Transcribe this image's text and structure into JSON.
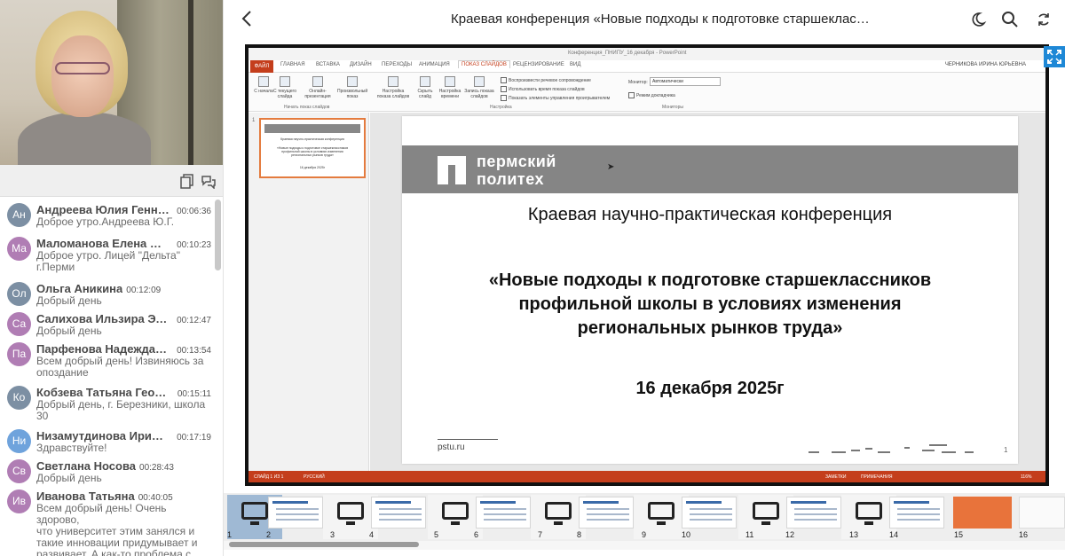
{
  "header": {
    "title": "Краевая конференция «Новые подходы к подготовке старшеклас…"
  },
  "chat": {
    "messages": [
      {
        "initials": "Ан",
        "color": "#7c8fa3",
        "name": "Андреева Юлия Геннад…",
        "time": "00:06:36",
        "text": "Доброе утро.Андреева Ю.Г."
      },
      {
        "initials": "Ма",
        "color": "#b07db4",
        "name": "Маломанова Елена Бор…",
        "time": "00:10:23",
        "text": "Доброе утро. Лицей \"Дельта\"\nг.Перми"
      },
      {
        "initials": "Ол",
        "color": "#7c8fa3",
        "name": "Ольга Аникина",
        "time": "00:12:09",
        "text": "Добрый день"
      },
      {
        "initials": "Са",
        "color": "#b07db4",
        "name": "Салихова Ильзира Эль…",
        "time": "00:12:47",
        "text": "Добрый день"
      },
      {
        "initials": "Па",
        "color": "#b07db4",
        "name": "Парфенова Надежда Н…",
        "time": "00:13:54",
        "text": "Всем добрый день! Извиняюсь за\nопоздание"
      },
      {
        "initials": "Ко",
        "color": "#7c8fa3",
        "name": "Кобзева Татьяна Георг…",
        "time": "00:15:11",
        "text": "Добрый день, г. Березники, школа\n30"
      },
      {
        "initials": "Ни",
        "color": "#6fa3dc",
        "name": "Низамутдинова Ирина …",
        "time": "00:17:19",
        "text": "Здравствуйте!"
      },
      {
        "initials": "Св",
        "color": "#b07db4",
        "name": "Светлана Носова",
        "time": "00:28:43",
        "text": "Добрый день"
      },
      {
        "initials": "Ив",
        "color": "#b07db4",
        "name": "Иванова Татьяна",
        "time": "00:40:05",
        "text": "Всем добрый день! Очень здорово,\nчто университет этим занялся и\nтакие инновации придумывает и\nразвивает. А как-то проблема с\nкадрами по физике, химии и\nнимиен, которые должны бать"
      }
    ]
  },
  "powerpoint": {
    "window_title": "Конференция_ПНИПУ_16 декабря - PowerPoint",
    "tabs": [
      "ФАЙЛ",
      "ГЛАВНАЯ",
      "ВСТАВКА",
      "ДИЗАЙН",
      "ПЕРЕХОДЫ",
      "АНИМАЦИЯ",
      "ПОКАЗ СЛАЙДОВ",
      "РЕЦЕНЗИРОВАНИЕ",
      "ВИД"
    ],
    "user": "ЧЕРНИКОВА ИРИНА ЮРЬЕВНА",
    "ribbon_buttons": [
      "С начала",
      "С текущего слайда",
      "Онлайн-презентация",
      "Произвольный показ",
      "Настройка показа слайдов",
      "Скрыть слайд",
      "Настройка времени",
      "Запись показа слайдов"
    ],
    "groups": [
      "Начать показ слайдов",
      "Настройка",
      "Мониторы"
    ],
    "checkboxes": [
      "Воспроизвести речевое сопровождение",
      "Использовать время показа слайдов",
      "Показать элементы управления проигрывателем"
    ],
    "monitor_label": "Монитор:",
    "monitor_value": "Автоматически",
    "presenter_view": "Режим докладчика",
    "status_slide": "СЛАЙД 1 ИЗ 1",
    "status_lang": "РУССКИЙ",
    "status_notes": "ЗАМЕТКИ",
    "status_comments": "ПРИМЕЧАНИЯ",
    "status_zoom": "116%"
  },
  "slide": {
    "logo_line1": "пермский",
    "logo_line2": "политех",
    "conference": "Краевая научно-практическая конференция",
    "heading": "«Новые подходы к подготовке старшеклассников профильной школы в условиях изменения региональных рынков труда»",
    "date": "16 декабря 2025г",
    "url": "pstu.ru",
    "number": "1"
  },
  "mini_slide": {
    "number": "1",
    "line1": "Краевая научно-практическая конференция",
    "line2": "«Новые подходы к подготовке старшеклассников профильной школы в условиях изменения региональных рынков труда»",
    "line3": "16 декабря 2025г"
  },
  "filmstrip": {
    "numbers": [
      "1",
      "2",
      "3",
      "4",
      "5",
      "6",
      "7",
      "8",
      "9",
      "10",
      "11",
      "12",
      "13",
      "14",
      "15",
      "16"
    ]
  }
}
